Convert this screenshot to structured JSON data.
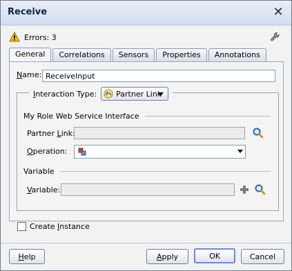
{
  "window": {
    "title": "Receive",
    "errors_label": "Errors: 3"
  },
  "tabs": [
    {
      "label": "General",
      "active": true
    },
    {
      "label": "Correlations",
      "active": false
    },
    {
      "label": "Sensors",
      "active": false
    },
    {
      "label": "Properties",
      "active": false
    },
    {
      "label": "Annotations",
      "active": false
    }
  ],
  "general": {
    "name_label_prefix": "N",
    "name_label_rest": "ame:",
    "name_value": "ReceiveInput",
    "interaction_type_label_prefix": "I",
    "interaction_type_label_rest": "nteraction Type:",
    "interaction_type_value": "Partner Link",
    "my_role_section_title": "My Role Web Service Interface",
    "partner_link_label_prefix": "Partner ",
    "partner_link_label_u": "L",
    "partner_link_label_rest": "ink:",
    "partner_link_value": "",
    "operation_label_prefix": "O",
    "operation_label_rest": "peration:",
    "operation_value": "",
    "variable_section_title": "Variable",
    "variable_label_prefix": "V",
    "variable_label_rest": "ariable:",
    "variable_value": "",
    "create_instance_label_prefix": "Create ",
    "create_instance_label_u": "I",
    "create_instance_label_rest": "nstance",
    "create_instance_checked": false
  },
  "footer": {
    "help_prefix": "H",
    "help_rest": "elp",
    "apply_prefix": "A",
    "apply_rest": "pply",
    "ok_label": "OK",
    "cancel_label": "Cancel"
  },
  "icons": {
    "close": "close-x-icon",
    "warning": "warning-icon",
    "wrench": "wrench-icon",
    "partner_link_icon": "partner-link-icon",
    "search": "search-icon",
    "add": "add-icon",
    "operation_icon": "operation-icon"
  }
}
